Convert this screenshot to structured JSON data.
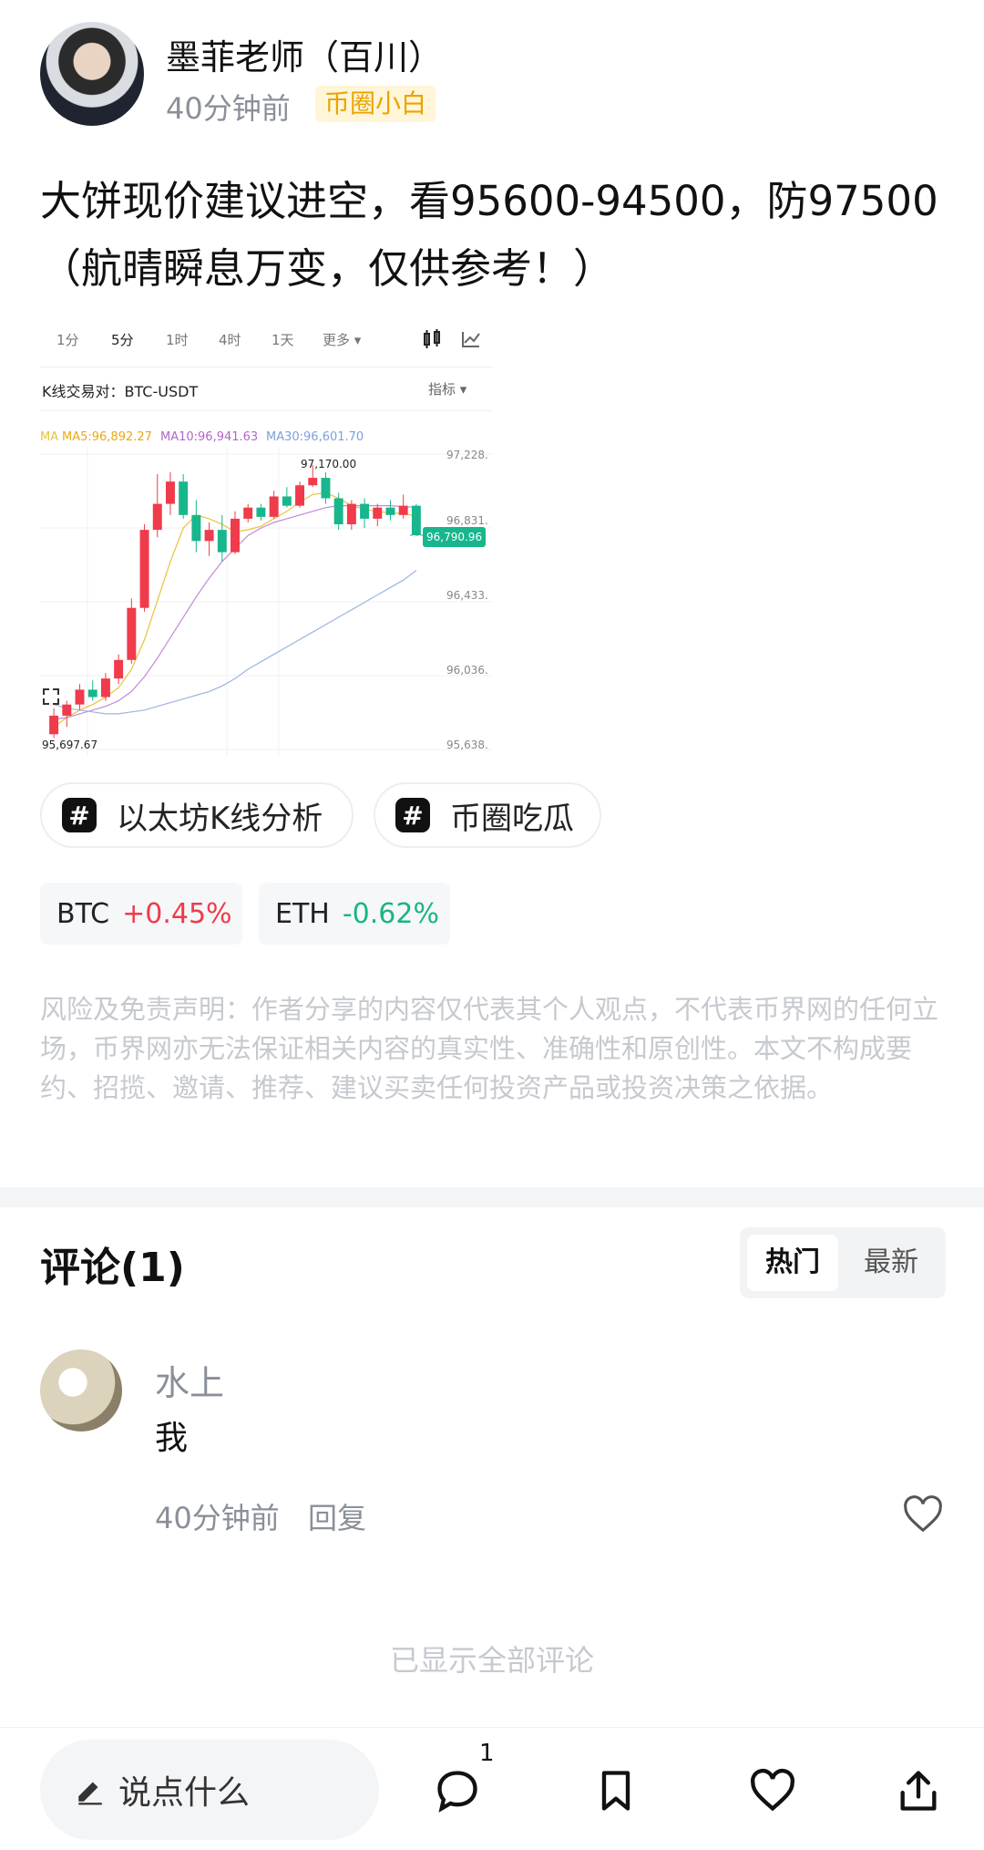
{
  "author": {
    "name": "墨菲老师（百川）",
    "time": "40分钟前",
    "badge": "币圈小白"
  },
  "post": {
    "line1": "大饼现价建议进空，看95600-94500，防97500",
    "line2": "（航晴瞬息万变，仅供参考！）"
  },
  "chart": {
    "timeframes": [
      "1分",
      "5分",
      "1时",
      "4时",
      "1天",
      "更多 ▾"
    ],
    "selected_timeframe": "5分",
    "pair_label": "K线交易对：BTC-USDT",
    "indicator_label": "指标 ▾",
    "ma5": "MA5:96,892.27",
    "ma10": "MA10:96,941.63",
    "ma30": "MA30:96,601.70",
    "ma_prefix": "MA",
    "colors": {
      "up": "#ef3b4b",
      "down": "#18b68c",
      "ma5": "#e8c33a",
      "ma10": "#c08ad8",
      "ma30": "#9db4e0"
    }
  },
  "chart_data": {
    "type": "candlestick",
    "title": "",
    "pair": "BTC-USDT",
    "interval": "5分",
    "y_ticks": [
      "97,228.",
      "96,831.",
      "96,433.",
      "96,036.",
      "95,638."
    ],
    "ylim": [
      95638,
      97228
    ],
    "last_price": "96,790.96",
    "high_label": "97,170.00",
    "low_label": "95,697.67",
    "candles": [
      {
        "o": 95720,
        "h": 95860,
        "l": 95700,
        "c": 95820
      },
      {
        "o": 95820,
        "h": 95900,
        "l": 95760,
        "c": 95880
      },
      {
        "o": 95880,
        "h": 95990,
        "l": 95850,
        "c": 95960
      },
      {
        "o": 95960,
        "h": 96010,
        "l": 95900,
        "c": 95920
      },
      {
        "o": 95920,
        "h": 96050,
        "l": 95900,
        "c": 96020
      },
      {
        "o": 96020,
        "h": 96150,
        "l": 95990,
        "c": 96120
      },
      {
        "o": 96120,
        "h": 96450,
        "l": 96100,
        "c": 96400
      },
      {
        "o": 96400,
        "h": 96850,
        "l": 96380,
        "c": 96820
      },
      {
        "o": 96820,
        "h": 97120,
        "l": 96780,
        "c": 96960
      },
      {
        "o": 96960,
        "h": 97130,
        "l": 96900,
        "c": 97080
      },
      {
        "o": 97080,
        "h": 97120,
        "l": 96880,
        "c": 96900
      },
      {
        "o": 96900,
        "h": 96980,
        "l": 96700,
        "c": 96760
      },
      {
        "o": 96760,
        "h": 96860,
        "l": 96680,
        "c": 96820
      },
      {
        "o": 96820,
        "h": 96900,
        "l": 96650,
        "c": 96700
      },
      {
        "o": 96700,
        "h": 96920,
        "l": 96690,
        "c": 96880
      },
      {
        "o": 96880,
        "h": 96960,
        "l": 96860,
        "c": 96940
      },
      {
        "o": 96940,
        "h": 96960,
        "l": 96870,
        "c": 96890
      },
      {
        "o": 96890,
        "h": 97030,
        "l": 96880,
        "c": 97000
      },
      {
        "o": 97000,
        "h": 97050,
        "l": 96940,
        "c": 96950
      },
      {
        "o": 96950,
        "h": 97080,
        "l": 96940,
        "c": 97060
      },
      {
        "o": 97060,
        "h": 97170,
        "l": 97050,
        "c": 97100
      },
      {
        "o": 97100,
        "h": 97130,
        "l": 96960,
        "c": 96990
      },
      {
        "o": 96990,
        "h": 97020,
        "l": 96820,
        "c": 96850
      },
      {
        "o": 96850,
        "h": 96980,
        "l": 96820,
        "c": 96960
      },
      {
        "o": 96960,
        "h": 96990,
        "l": 96830,
        "c": 96880
      },
      {
        "o": 96880,
        "h": 96960,
        "l": 96840,
        "c": 96940
      },
      {
        "o": 96940,
        "h": 96980,
        "l": 96870,
        "c": 96900
      },
      {
        "o": 96900,
        "h": 97010,
        "l": 96880,
        "c": 96950
      },
      {
        "o": 96950,
        "h": 96960,
        "l": 96790,
        "c": 96791
      }
    ],
    "series": [
      {
        "name": "MA5",
        "values": [
          95760,
          95810,
          95850,
          95880,
          95920,
          95970,
          96070,
          96230,
          96440,
          96650,
          96830,
          96900,
          96880,
          96850,
          96810,
          96820,
          96840,
          96880,
          96920,
          96970,
          97010,
          97020,
          96990,
          96950,
          96930,
          96920,
          96910,
          96910,
          96892
        ]
      },
      {
        "name": "MA10",
        "values": [
          95800,
          95810,
          95830,
          95850,
          95870,
          95900,
          95950,
          96030,
          96130,
          96240,
          96350,
          96460,
          96560,
          96650,
          96720,
          96790,
          96830,
          96860,
          96880,
          96900,
          96920,
          96940,
          96950,
          96950,
          96950,
          96950,
          96950,
          96945,
          96942
        ]
      },
      {
        "name": "MA30",
        "values": [
          95880,
          95860,
          95850,
          95840,
          95830,
          95830,
          95840,
          95850,
          95870,
          95890,
          95910,
          95930,
          95950,
          95980,
          96020,
          96070,
          96110,
          96150,
          96190,
          96230,
          96270,
          96310,
          96350,
          96390,
          96430,
          96470,
          96510,
          96550,
          96602
        ]
      }
    ]
  },
  "tags": [
    {
      "label": "以太坊K线分析"
    },
    {
      "label": "币圈吃瓜"
    }
  ],
  "tickers": [
    {
      "symbol": "BTC",
      "change": "+0.45%"
    },
    {
      "symbol": "ETH",
      "change": "-0.62%"
    }
  ],
  "disclaimer": "风险及免责声明：作者分享的内容仅代表其个人观点，不代表币界网的任何立场，币界网亦无法保证相关内容的真实性、准确性和原创性。本文不构成要约、招揽、邀请、推荐、建议买卖任何投资产品或投资决策之依据。",
  "comments": {
    "title": "评论(1)",
    "sort_hot": "热门",
    "sort_new": "最新",
    "items": [
      {
        "user": "水上",
        "text": "我",
        "time": "40分钟前",
        "reply": "回复"
      }
    ],
    "all_shown": "已显示全部评论"
  },
  "bottom_bar": {
    "input_placeholder": "说点什么",
    "comment_count": "1",
    "icons": [
      "pencil-icon",
      "comment-icon",
      "bookmark-icon",
      "heart-icon",
      "share-icon"
    ]
  }
}
